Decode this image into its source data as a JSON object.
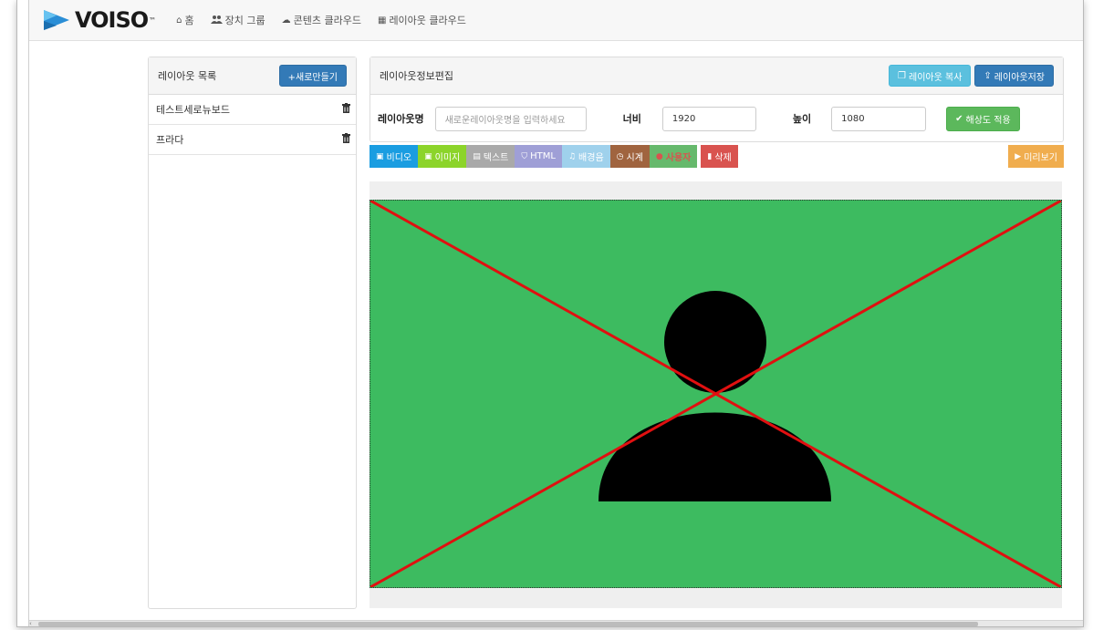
{
  "brand": {
    "name": "VOISO",
    "tm": "™"
  },
  "nav": [
    {
      "label": "홈",
      "icon": "home-icon",
      "glyph": "⌂"
    },
    {
      "label": "장치 그룹",
      "icon": "users-icon",
      "glyph": "👥"
    },
    {
      "label": "콘텐츠 클라우드",
      "icon": "cloud-icon",
      "glyph": "☁"
    },
    {
      "label": "레이아웃 클라우드",
      "icon": "layout-icon",
      "glyph": "▦"
    }
  ],
  "layout_list": {
    "title": "레이아웃 목록",
    "new_button": "+새로만들기",
    "items": [
      {
        "label": "테스트세로뉴보드"
      },
      {
        "label": "프라다"
      }
    ]
  },
  "editor": {
    "title": "레이아웃정보편집",
    "copy_button": "레이아웃 복사",
    "save_button": "레이아웃저장",
    "name_label": "레이아웃명",
    "name_placeholder": "새로운레이아웃명을 입력하세요",
    "width_label": "너비",
    "width_value": "1920",
    "height_label": "높이",
    "height_value": "1080",
    "apply_button": "해상도 적용"
  },
  "toolbar": {
    "video": "비디오",
    "image": "이미지",
    "text": "텍스트",
    "html": "HTML",
    "bgm": "배경음",
    "clock": "시계",
    "user": "사용자",
    "delete": "삭제",
    "preview": "미리보기"
  },
  "colors": {
    "video": "#1a9de1",
    "image": "#8cd42a",
    "text": "#a9a9a9",
    "html": "#9f9fd6",
    "bgm": "#9fd1ec",
    "clock": "#a0643f",
    "user": "#66b96c",
    "user_text": "#d9534f",
    "delete": "#d9534f",
    "preview": "#f0ad4e",
    "canvas": "#3dbb60"
  }
}
